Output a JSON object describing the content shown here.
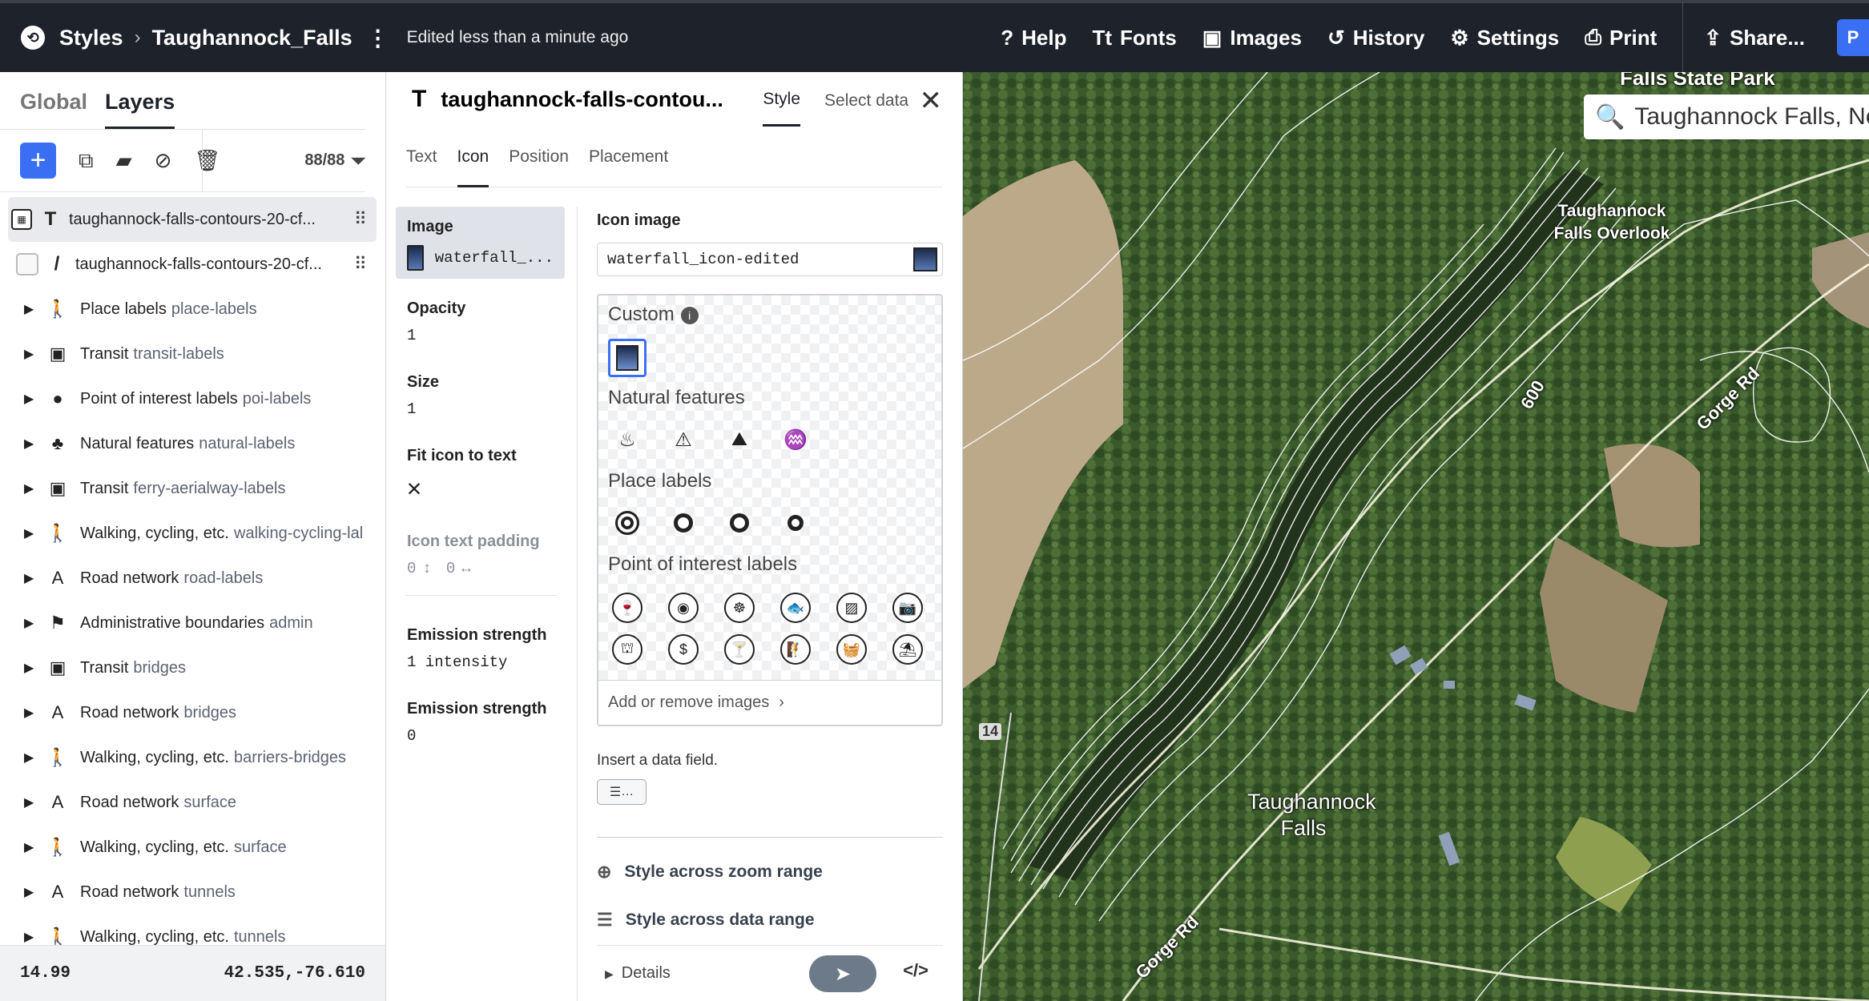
{
  "topbar": {
    "styles_label": "Styles",
    "style_name": "Taughannock_Falls",
    "edited": "Edited less than a minute ago",
    "buttons": [
      {
        "icon": "?",
        "label": "Help"
      },
      {
        "icon": "Tt",
        "label": "Fonts"
      },
      {
        "icon": "▣",
        "label": "Images"
      },
      {
        "icon": "↺",
        "label": "History"
      },
      {
        "icon": "⚙",
        "label": "Settings"
      },
      {
        "icon": "⎙",
        "label": "Print"
      },
      {
        "icon": "⇪",
        "label": "Share..."
      }
    ],
    "publish": "P"
  },
  "sidebar": {
    "tabs": [
      "Global",
      "Layers"
    ],
    "layer_count": "88/88",
    "layers": [
      {
        "type": "T",
        "name": "taughannock-falls-contours-20-cf..."
      },
      {
        "type": "/",
        "name": "taughannock-falls-contours-20-cf..."
      }
    ],
    "groups": [
      {
        "icon": "🚶",
        "name": "Place labels",
        "sub": "place-labels"
      },
      {
        "icon": "▣",
        "name": "Transit",
        "sub": "transit-labels"
      },
      {
        "icon": "●",
        "name": "Point of interest labels",
        "sub": "poi-labels"
      },
      {
        "icon": "♣",
        "name": "Natural features",
        "sub": "natural-labels"
      },
      {
        "icon": "▣",
        "name": "Transit",
        "sub": "ferry-aerialway-labels"
      },
      {
        "icon": "🚶",
        "name": "Walking, cycling, etc.",
        "sub": "walking-cycling-lal"
      },
      {
        "icon": "A",
        "name": "Road network",
        "sub": "road-labels"
      },
      {
        "icon": "⚑",
        "name": "Administrative boundaries",
        "sub": "admin"
      },
      {
        "icon": "▣",
        "name": "Transit",
        "sub": "bridges"
      },
      {
        "icon": "A",
        "name": "Road network",
        "sub": "bridges"
      },
      {
        "icon": "🚶",
        "name": "Walking, cycling, etc.",
        "sub": "barriers-bridges"
      },
      {
        "icon": "A",
        "name": "Road network",
        "sub": "surface"
      },
      {
        "icon": "🚶",
        "name": "Walking, cycling, etc.",
        "sub": "surface"
      },
      {
        "icon": "A",
        "name": "Road network",
        "sub": "tunnels"
      },
      {
        "icon": "🚶",
        "name": "Walking, cycling, etc.",
        "sub": "tunnels"
      }
    ],
    "zoom": "14.99",
    "coords": "42.535,-76.610"
  },
  "editor": {
    "title": "taughannock-falls-contou...",
    "tabs": [
      "Style",
      "Select data"
    ],
    "subtabs": [
      "Text",
      "Icon",
      "Position",
      "Placement"
    ],
    "props": {
      "image": {
        "label": "Image",
        "value": "waterfall_..."
      },
      "opacity": {
        "label": "Opacity",
        "value": "1"
      },
      "size": {
        "label": "Size",
        "value": "1"
      },
      "fit": {
        "label": "Fit icon to text",
        "value": "✕"
      },
      "padding": {
        "label": "Icon text padding",
        "v1": "0",
        "v2": "0"
      },
      "emission1": {
        "label": "Emission strength",
        "value": "1 intensity"
      },
      "emission2": {
        "label": "Emission strength",
        "value": "0"
      }
    },
    "icon_image_label": "Icon image",
    "icon_image_value": "waterfall_icon-edited",
    "picker": {
      "custom": "Custom",
      "natural": "Natural features",
      "place": "Place labels",
      "poi": "Point of interest labels",
      "footer": "Add or remove images"
    },
    "insert_label": "Insert a data field.",
    "insert_btn": "…",
    "across_zoom": "Style across zoom range",
    "across_data": "Style across data range",
    "details": "Details"
  },
  "map": {
    "search": "Taughannock Falls, Ne",
    "labels": {
      "park": "Falls State Park",
      "overlook": "Taughannock Falls Overlook",
      "falls": "Taughannock Falls",
      "gorge1": "Gorge Rd",
      "gorge2": "Gorge Rd",
      "contour": "600",
      "route": "14"
    },
    "colors": {
      "forest": "#37552b",
      "field": "#b9a584",
      "lines": "#ffffff"
    }
  }
}
